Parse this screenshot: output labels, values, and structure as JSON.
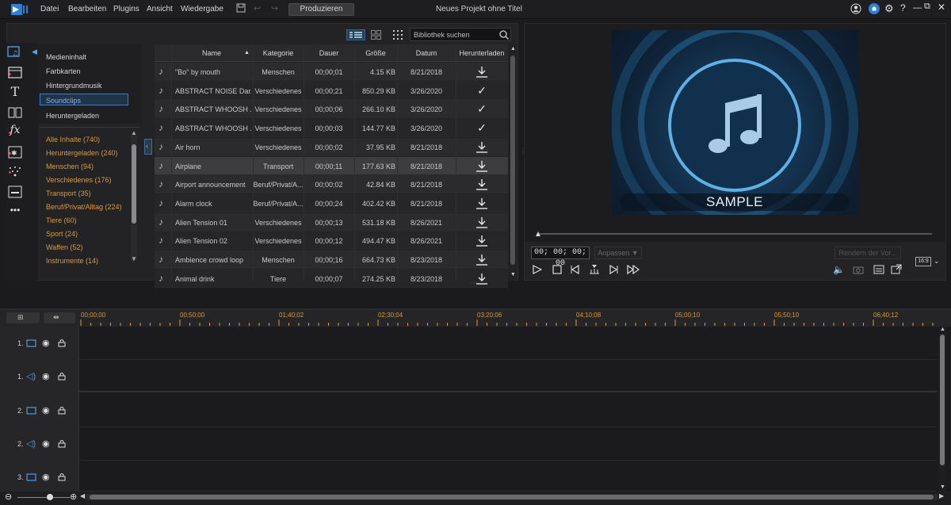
{
  "titlebar": {
    "menu": [
      "Datei",
      "Bearbeiten",
      "Plugins",
      "Ansicht",
      "Wiedergabe"
    ],
    "produce_label": "Produzieren",
    "project_title": "Neues Projekt ohne Titel"
  },
  "library": {
    "search_placeholder": "Bibliothek suchen",
    "categories_top": [
      "Medieninhalt",
      "Farbkarten",
      "Hintergrundmusik",
      "Soundclips",
      "Heruntergeladen"
    ],
    "selected_category": "Soundclips",
    "categories": [
      "Alle Inhalte  (740)",
      "Heruntergeladen  (240)",
      "Menschen  (94)",
      "Verschiedenes  (176)",
      "Transport  (35)",
      "Beruf/Privat/Alltag  (224)",
      "Tiere  (60)",
      "Sport  (24)",
      "Waffen  (52)",
      "Instrumente  (14)"
    ],
    "columns": [
      "Name",
      "Kategorie",
      "Dauer",
      "Größe",
      "Datum",
      "Herunterladen"
    ],
    "rows": [
      {
        "name": "\"Bo\" by mouth",
        "category": "Menschen",
        "duration": "00;00;01",
        "size": "4.15 KB",
        "date": "8/21/2018",
        "status": "download"
      },
      {
        "name": "ABSTRACT NOISE Dar...",
        "category": "Verschiedenes",
        "duration": "00;00;21",
        "size": "850.29 KB",
        "date": "3/26/2020",
        "status": "done"
      },
      {
        "name": "ABSTRACT WHOOSH ...",
        "category": "Verschiedenes",
        "duration": "00;00;06",
        "size": "266.10 KB",
        "date": "3/26/2020",
        "status": "done"
      },
      {
        "name": "ABSTRACT WHOOSH ...",
        "category": "Verschiedenes",
        "duration": "00;00;03",
        "size": "144.77 KB",
        "date": "3/26/2020",
        "status": "done"
      },
      {
        "name": "Air horn",
        "category": "Verschiedenes",
        "duration": "00;00;02",
        "size": "37.95 KB",
        "date": "8/21/2018",
        "status": "download"
      },
      {
        "name": "Airplane",
        "category": "Transport",
        "duration": "00;00;11",
        "size": "177.63 KB",
        "date": "8/21/2018",
        "status": "download"
      },
      {
        "name": "Airport announcement",
        "category": "Beruf/Privat/A...",
        "duration": "00;00;02",
        "size": "42.84 KB",
        "date": "8/21/2018",
        "status": "download"
      },
      {
        "name": "Alarm clock",
        "category": "Beruf/Privat/A...",
        "duration": "00;00;24",
        "size": "402.42 KB",
        "date": "8/21/2018",
        "status": "download"
      },
      {
        "name": "Alien Tension 01",
        "category": "Verschiedenes",
        "duration": "00;00;13",
        "size": "531.18 KB",
        "date": "8/26/2021",
        "status": "download"
      },
      {
        "name": "Alien Tension 02",
        "category": "Verschiedenes",
        "duration": "00;00;12",
        "size": "494.47 KB",
        "date": "8/26/2021",
        "status": "download"
      },
      {
        "name": "Ambience crowd loop",
        "category": "Menschen",
        "duration": "00;00;16",
        "size": "664.73 KB",
        "date": "8/23/2018",
        "status": "download"
      },
      {
        "name": "Animal drink",
        "category": "Tiere",
        "duration": "00;00;07",
        "size": "274.25 KB",
        "date": "8/23/2018",
        "status": "download"
      }
    ]
  },
  "preview": {
    "sample_text": "SAMPLE",
    "timecode": "00; 00; 00; 00",
    "fit_label": "Anpassen ▼",
    "render_label": "Rendern der Vor...",
    "aspect": "16:9"
  },
  "timeline": {
    "ruler": [
      "00;00;00",
      "00;50;00",
      "01;40;02",
      "02;30;04",
      "03;20;06",
      "04;10;08",
      "05;00;10",
      "05;50;10",
      "06;40;12"
    ],
    "tracks": [
      "1.",
      "1.",
      "2.",
      "2.",
      "3."
    ]
  },
  "colors": {
    "accent_blue": "#3a7bd5",
    "category_orange": "#d79a3c",
    "record_red": "#e53935"
  }
}
